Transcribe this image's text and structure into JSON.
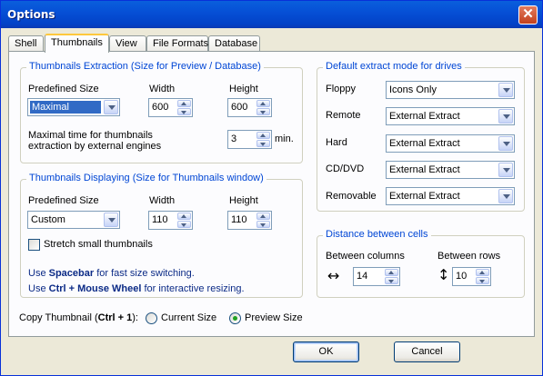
{
  "window": {
    "title": "Options",
    "close_glyph": "✕"
  },
  "tabs": [
    {
      "label": "Shell"
    },
    {
      "label": "Thumbnails"
    },
    {
      "label": "View"
    },
    {
      "label": "File Formats"
    },
    {
      "label": "Database"
    }
  ],
  "extraction": {
    "title": "Thumbnails Extraction (Size for Preview / Database)",
    "predefined_label": "Predefined Size",
    "predefined_value": "Maximal",
    "width_label": "Width",
    "width_value": "600",
    "height_label": "Height",
    "height_value": "600",
    "maxtime_label_1": "Maximal time for thumbnails",
    "maxtime_label_2": "extraction by external engines",
    "maxtime_value": "3",
    "maxtime_unit": "min."
  },
  "displaying": {
    "title": "Thumbnails Displaying (Size for Thumbnails window)",
    "predefined_label": "Predefined Size",
    "predefined_value": "Custom",
    "width_label": "Width",
    "width_value": "110",
    "height_label": "Height",
    "height_value": "110",
    "stretch_label": "Stretch small thumbnails",
    "stretch_checked": false,
    "hint1_pre": "Use ",
    "hint1_key": "Spacebar",
    "hint1_post": " for fast size switching.",
    "hint2_pre": "Use ",
    "hint2_key": "Ctrl + Mouse Wheel",
    "hint2_post": " for interactive resizing."
  },
  "drives": {
    "title": "Default extract mode for drives",
    "rows": [
      {
        "label": "Floppy",
        "value": "Icons Only"
      },
      {
        "label": "Remote",
        "value": "External Extract"
      },
      {
        "label": "Hard",
        "value": "External Extract"
      },
      {
        "label": "CD/DVD",
        "value": "External Extract"
      },
      {
        "label": "Removable",
        "value": "External Extract"
      }
    ]
  },
  "distance": {
    "title": "Distance between cells",
    "cols_label": "Between columns",
    "cols_value": "14",
    "rows_label": "Between rows",
    "rows_value": "10",
    "h_arrow_glyph": "↔",
    "v_arrow_glyph": "↕"
  },
  "copy": {
    "label_pre": "Copy Thumbnail (",
    "label_key": "Ctrl + 1",
    "label_post": "):",
    "current_label": "Current Size",
    "preview_label": "Preview Size",
    "selected": "preview"
  },
  "buttons": {
    "ok": "OK",
    "cancel": "Cancel"
  }
}
